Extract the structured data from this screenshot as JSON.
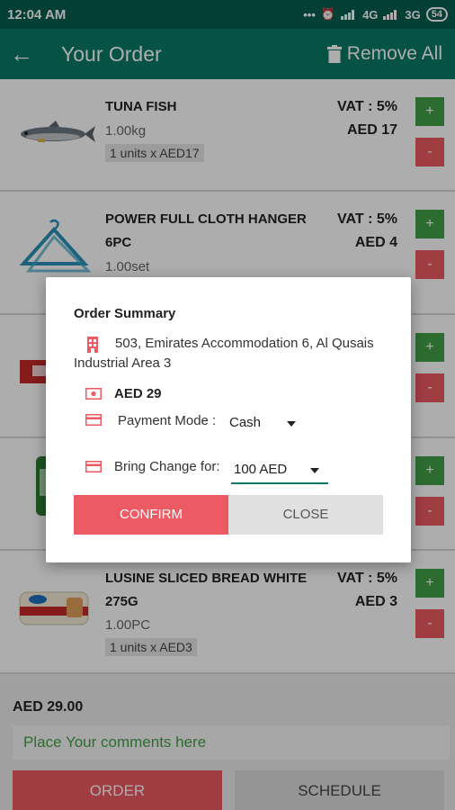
{
  "statusbar": {
    "time": "12:04 AM",
    "network_1": "4G",
    "network_2": "3G",
    "battery": "54"
  },
  "appbar": {
    "title": "Your Order",
    "remove_all": "Remove All"
  },
  "items": [
    {
      "name": "TUNA FISH",
      "qty": "1.00kg",
      "units": "1 units x AED17",
      "vat": "VAT : 5%",
      "price": "AED 17",
      "plus": "+",
      "minus": "-"
    },
    {
      "name": "POWER FULL CLOTH HANGER 6PC",
      "qty": "1.00set",
      "vat": "VAT : 5%",
      "price": "AED 4",
      "plus": "+",
      "minus": "-"
    },
    {
      "plus": "+",
      "minus": "-"
    },
    {
      "plus": "+",
      "minus": "-"
    },
    {
      "name": "LUSINE SLICED BREAD WHITE 275G",
      "qty": "1.00PC",
      "units": "1 units x AED3",
      "vat": "VAT : 5%",
      "price": "AED 3",
      "plus": "+",
      "minus": "-"
    }
  ],
  "dialog": {
    "title": "Order Summary",
    "address": "503, Emirates Accommodation 6, Al Qusais Industrial Area 3",
    "amount": "AED 29",
    "payment_mode_label": "Payment Mode :",
    "payment_mode_value": "Cash",
    "bring_change_label": "Bring Change for:",
    "bring_change_value": "100 AED",
    "confirm": "CONFIRM",
    "close": "CLOSE"
  },
  "footer": {
    "total": "AED 29.00",
    "comments_placeholder": "Place Your comments here",
    "order": "ORDER",
    "schedule": "SCHEDULE"
  },
  "colors": {
    "primary_dark": "#055d4f",
    "primary": "#0a7a66",
    "accent_red": "#ec5a63",
    "accent_green": "#43a047"
  }
}
